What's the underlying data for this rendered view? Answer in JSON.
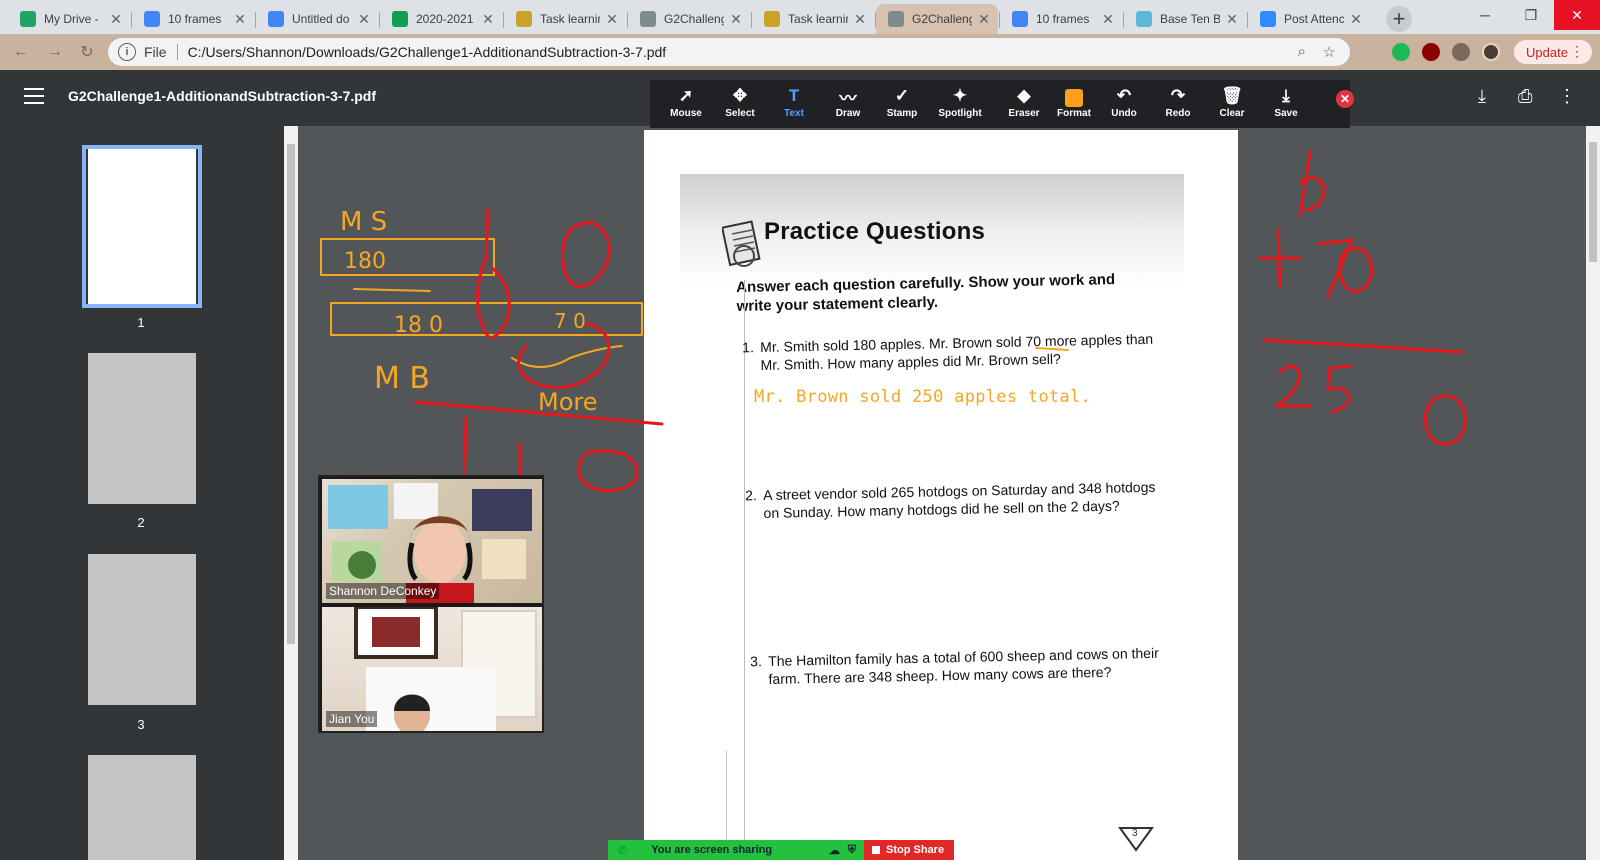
{
  "browser": {
    "tabs": [
      {
        "title": "My Drive -",
        "icon": "drive-icon",
        "color": "#1fa463",
        "active": false
      },
      {
        "title": "10 frames",
        "icon": "docs-icon",
        "color": "#4285f4",
        "active": false
      },
      {
        "title": "Untitled do",
        "icon": "docs-icon",
        "color": "#4285f4",
        "active": false
      },
      {
        "title": "2020-2021",
        "icon": "sheets-icon",
        "color": "#0f9d58",
        "active": false
      },
      {
        "title": "Task learnir",
        "icon": "page-icon",
        "color": "#c9a227",
        "active": false
      },
      {
        "title": "G2Challeng",
        "icon": "globe-icon",
        "color": "#7f8c8d",
        "active": false
      },
      {
        "title": "Task learnir",
        "icon": "page-icon",
        "color": "#c9a227",
        "active": false
      },
      {
        "title": "G2Challeng",
        "icon": "globe-icon",
        "color": "#7f8c8d",
        "active": true
      },
      {
        "title": "10 frames",
        "icon": "docs-icon",
        "color": "#4285f4",
        "active": false
      },
      {
        "title": "Base Ten Bl",
        "icon": "app-icon",
        "color": "#5bb8d6",
        "active": false
      },
      {
        "title": "Post Attenc",
        "icon": "zoom-icon",
        "color": "#2d8cff",
        "active": false
      }
    ],
    "address": {
      "scheme": "File",
      "url": "C:/Users/Shannon/Downloads/G2Challenge1-AdditionandSubtraction-3-7.pdf"
    },
    "update_label": "Update"
  },
  "pdf": {
    "title": "G2Challenge1-AdditionandSubtraction-3-7.pdf",
    "tools": [
      {
        "label": "Mouse",
        "glyph": "➚"
      },
      {
        "label": "Select",
        "glyph": "✥"
      },
      {
        "label": "Text",
        "glyph": "T"
      },
      {
        "label": "Draw",
        "glyph": "〰"
      },
      {
        "label": "Stamp",
        "glyph": "✓"
      },
      {
        "label": "Spotlight",
        "glyph": "✦"
      },
      {
        "label": "Eraser",
        "glyph": "◆"
      },
      {
        "label": "Format",
        "glyph": ""
      },
      {
        "label": "Undo",
        "glyph": "↶"
      },
      {
        "label": "Redo",
        "glyph": "↷"
      },
      {
        "label": "Clear",
        "glyph": "🗑"
      },
      {
        "label": "Save",
        "glyph": "⤓"
      }
    ],
    "active_tool": "Text",
    "format_color": "#ff9f1a",
    "pages": [
      "1",
      "2",
      "3"
    ]
  },
  "document": {
    "heading": "Practice Questions",
    "instructions": "Answer each question carefully. Show your work and write your statement clearly.",
    "questions": [
      {
        "num": "1.",
        "text": "Mr. Smith sold 180 apples. Mr. Brown sold 70 more apples than Mr. Smith. How many apples did Mr. Brown sell?"
      },
      {
        "num": "2.",
        "text": "A street vendor sold 265 hotdogs on Saturday and 348 hotdogs on Sunday. How many hotdogs did he sell on the 2 days?"
      },
      {
        "num": "3.",
        "text": "The Hamilton family has a total of 600 sheep and cows on their farm. There are 348 sheep. How many cows are there?"
      }
    ],
    "typed_answer": "Mr. Brown sold 250 apples total.",
    "page_corner": "3"
  },
  "handwriting": {
    "ms": "M S",
    "box1": "180",
    "box2_left": "18 0",
    "box2_right": "7 0",
    "mb": "M B",
    "more": "More",
    "right_top": "180",
    "right_add": "+70",
    "right_sum": "250",
    "ink_red": "#e8161b",
    "ink_orange": "#f5a623"
  },
  "zoom": {
    "participants": [
      "Shannon DeConkey",
      "Jian You"
    ],
    "share_status": "You are screen sharing",
    "stop_label": "Stop Share"
  }
}
